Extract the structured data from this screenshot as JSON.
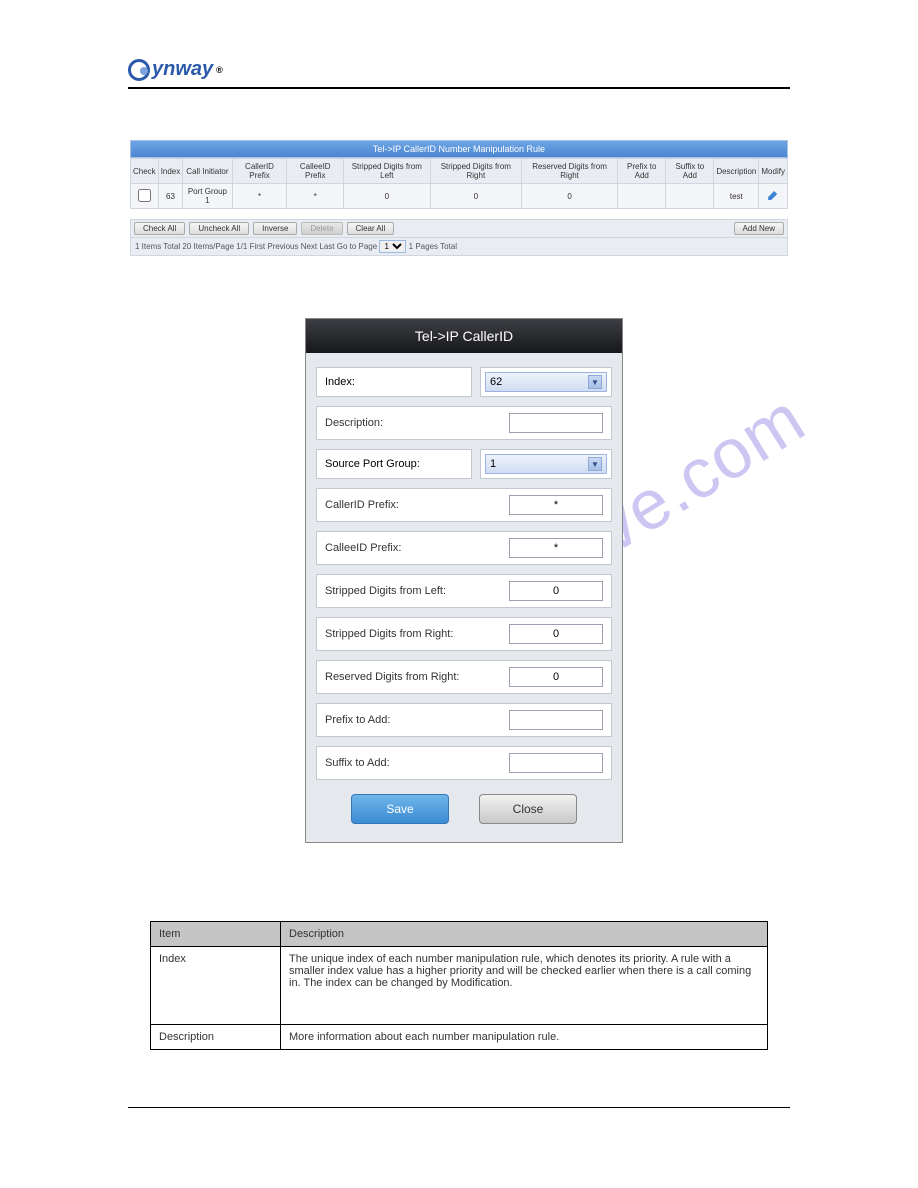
{
  "logo": {
    "text": "ynway",
    "reg": "®"
  },
  "ruleTable": {
    "title": "Tel->IP CallerID Number Manipulation Rule",
    "headers": [
      "Check",
      "Index",
      "Call Initiator",
      "CallerID Prefix",
      "CalleeID Prefix",
      "Stripped Digits from Left",
      "Stripped Digits from Right",
      "Reserved Digits from Right",
      "Prefix to Add",
      "Suffix to Add",
      "Description",
      "Modify"
    ],
    "row": {
      "index": "63",
      "call_initiator": "Port Group 1",
      "callerid_prefix": "*",
      "calleeid_prefix": "*",
      "stripped_left": "0",
      "stripped_right": "0",
      "reserved_right": "0",
      "prefix_to_add": "",
      "suffix_to_add": "",
      "description": "test"
    }
  },
  "actions": {
    "check_all": "Check All",
    "uncheck_all": "Uncheck All",
    "inverse": "Inverse",
    "delete": "Delete",
    "clear_all": "Clear All",
    "add_new": "Add New"
  },
  "pager": {
    "text_left": "1 Items Total  20 Items/Page  1/1  First  Previous  Next  Last  Go to Page",
    "text_right": "1 Pages Total",
    "page_value": "1"
  },
  "dialog": {
    "title": "Tel->IP CallerID",
    "index_label": "Index:",
    "index_value": "62",
    "description_label": "Description:",
    "description_value": "",
    "source_port_group_label": "Source Port Group:",
    "source_port_group_value": "1",
    "callerid_prefix_label": "CallerID Prefix:",
    "callerid_prefix_value": "*",
    "calleeid_prefix_label": "CalleeID Prefix:",
    "calleeid_prefix_value": "*",
    "stripped_left_label": "Stripped Digits from Left:",
    "stripped_left_value": "0",
    "stripped_right_label": "Stripped Digits from Right:",
    "stripped_right_value": "0",
    "reserved_right_label": "Reserved Digits from Right:",
    "reserved_right_value": "0",
    "prefix_to_add_label": "Prefix to Add:",
    "prefix_to_add_value": "",
    "suffix_to_add_label": "Suffix to Add:",
    "suffix_to_add_value": "",
    "save": "Save",
    "close": "Close"
  },
  "itemTable": {
    "headers": [
      "Item",
      "Description"
    ],
    "rows": [
      {
        "item": "Index",
        "desc": "The unique index of each number manipulation rule, which denotes its priority. A rule with a smaller index value has a higher priority and will be checked earlier when there is a call coming in. The index can be changed by Modification."
      },
      {
        "item": "Description",
        "desc": "More information about each number manipulation rule."
      }
    ]
  },
  "watermark": "manualshive.com"
}
